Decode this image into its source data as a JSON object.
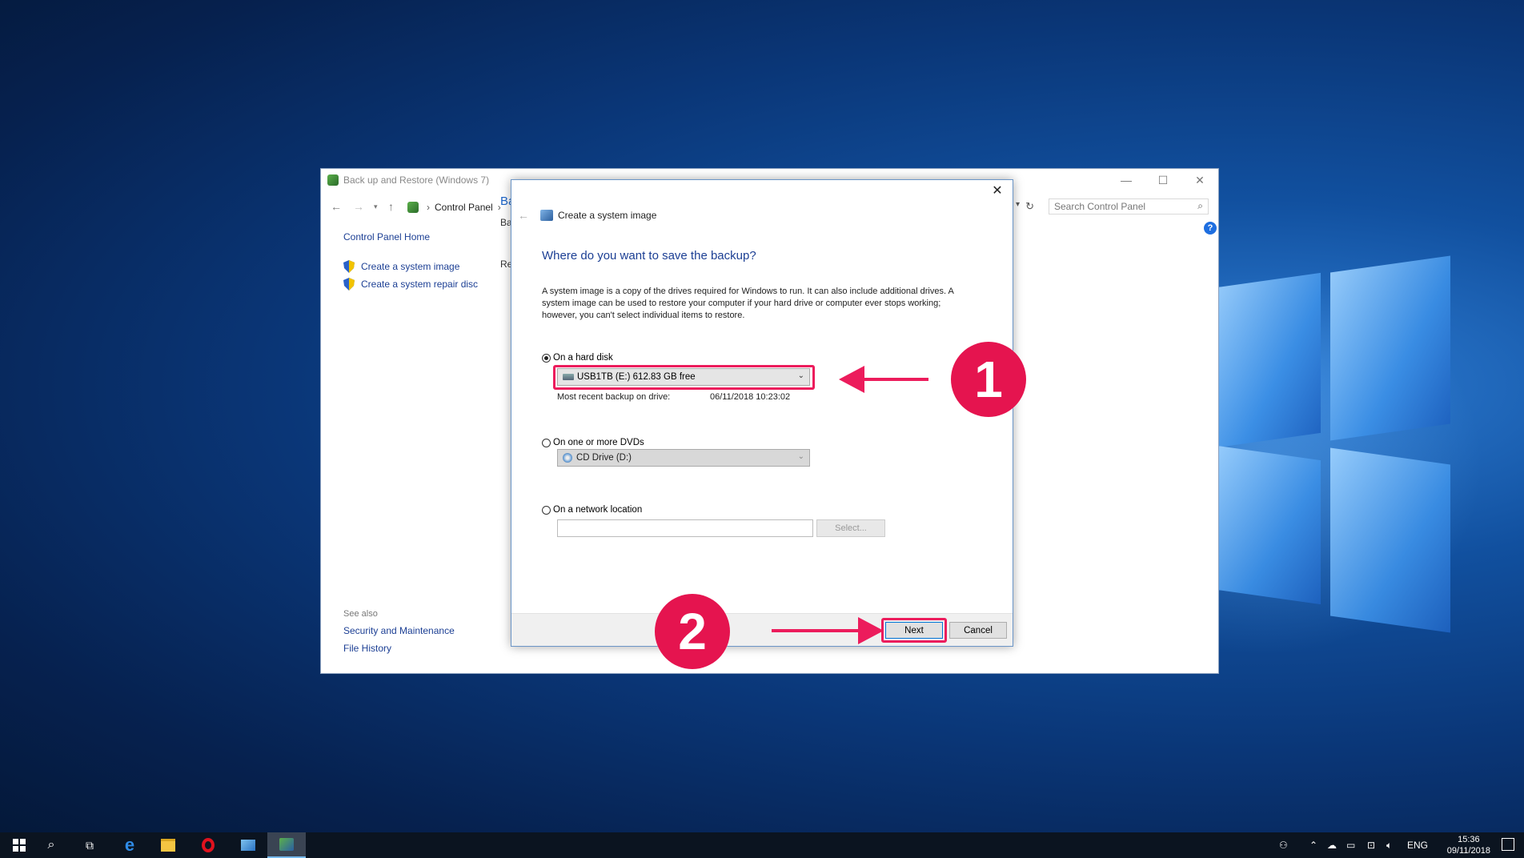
{
  "background_window": {
    "title": "Back up and Restore (Windows 7)",
    "breadcrumb": "Control Panel",
    "search_placeholder": "Search Control Panel",
    "nav_home": "Control Panel Home",
    "tasks": [
      "Create a system image",
      "Create a system repair disc"
    ],
    "fragments": [
      "Ba",
      "Ba",
      "Re"
    ],
    "see_also_heading": "See also",
    "see_also_links": [
      "Security and Maintenance",
      "File History"
    ],
    "help": "?",
    "minimize": "—",
    "maximize": "☐",
    "close": "✕"
  },
  "dialog": {
    "title": "Create a system image",
    "question": "Where do you want to save the backup?",
    "description": "A system image is a copy of the drives required for Windows to run. It can also include additional drives. A system image can be used to restore your computer if your hard drive or computer ever stops working; however, you can't select individual items to restore.",
    "options": {
      "hard_disk": {
        "label": "On a hard disk",
        "selected": true,
        "drive": "USB1TB (E:)  612.83 GB free",
        "recent_label": "Most recent backup on drive:",
        "recent_value": "06/11/2018 10:23:02"
      },
      "dvd": {
        "label": "On one or more DVDs",
        "selected": false,
        "drive": "CD Drive (D:)"
      },
      "network": {
        "label": "On a network location",
        "selected": false,
        "value": "",
        "select_button": "Select..."
      }
    },
    "buttons": {
      "next": "Next",
      "cancel": "Cancel"
    },
    "close": "✕"
  },
  "annotations": {
    "step1": "1",
    "step2": "2",
    "accent_color": "#ec1c5c"
  },
  "taskbar": {
    "items": [
      "start-icon",
      "search-icon",
      "task-view-icon",
      "edge-icon",
      "file-explorer-icon",
      "opera-icon",
      "store-icon",
      "backup-app-icon"
    ],
    "language": "ENG",
    "time": "15:36",
    "date": "09/11/2018"
  }
}
